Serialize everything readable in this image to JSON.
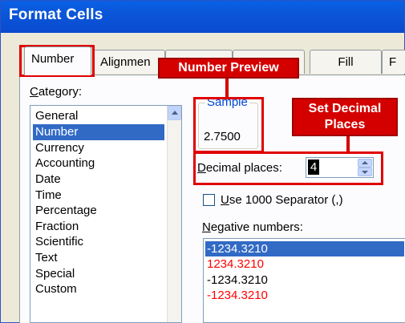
{
  "window": {
    "title": "Format Cells"
  },
  "tabs": [
    {
      "label": "Number",
      "active": true
    },
    {
      "label": "Alignmen",
      "active": false
    },
    {
      "label": "",
      "active": false
    },
    {
      "label": "",
      "active": false
    },
    {
      "label": "Fill",
      "active": false
    },
    {
      "label": "F",
      "active": false
    }
  ],
  "category": {
    "label_pre": "",
    "label_ul": "C",
    "label_post": "ategory:",
    "items": [
      "General",
      "Number",
      "Currency",
      "Accounting",
      "Date",
      "Time",
      "Percentage",
      "Fraction",
      "Scientific",
      "Text",
      "Special",
      "Custom"
    ],
    "selected": "Number"
  },
  "sample": {
    "legend": "Sample",
    "value": "2.7500"
  },
  "decimal": {
    "label_ul": "D",
    "label_post": "ecimal places:",
    "value": "4"
  },
  "separator": {
    "label_ul": "U",
    "label_post": "se 1000 Separator (,)",
    "checked": false
  },
  "negative": {
    "label_ul": "N",
    "label_post": "egative numbers:",
    "items": [
      {
        "text": "-1234.3210",
        "style": "selected"
      },
      {
        "text": "1234.3210",
        "style": "red"
      },
      {
        "text": "-1234.3210",
        "style": "black"
      },
      {
        "text": "-1234.3210",
        "style": "red"
      }
    ]
  },
  "annotations": {
    "number_preview": "Number Preview",
    "set_decimal_line1": "Set Decimal",
    "set_decimal_line2": "Places"
  },
  "colors": {
    "title_bar": "#0a56d8",
    "callout": "#d40000",
    "selection": "#316ac5",
    "negative_red": "#ff0000"
  }
}
